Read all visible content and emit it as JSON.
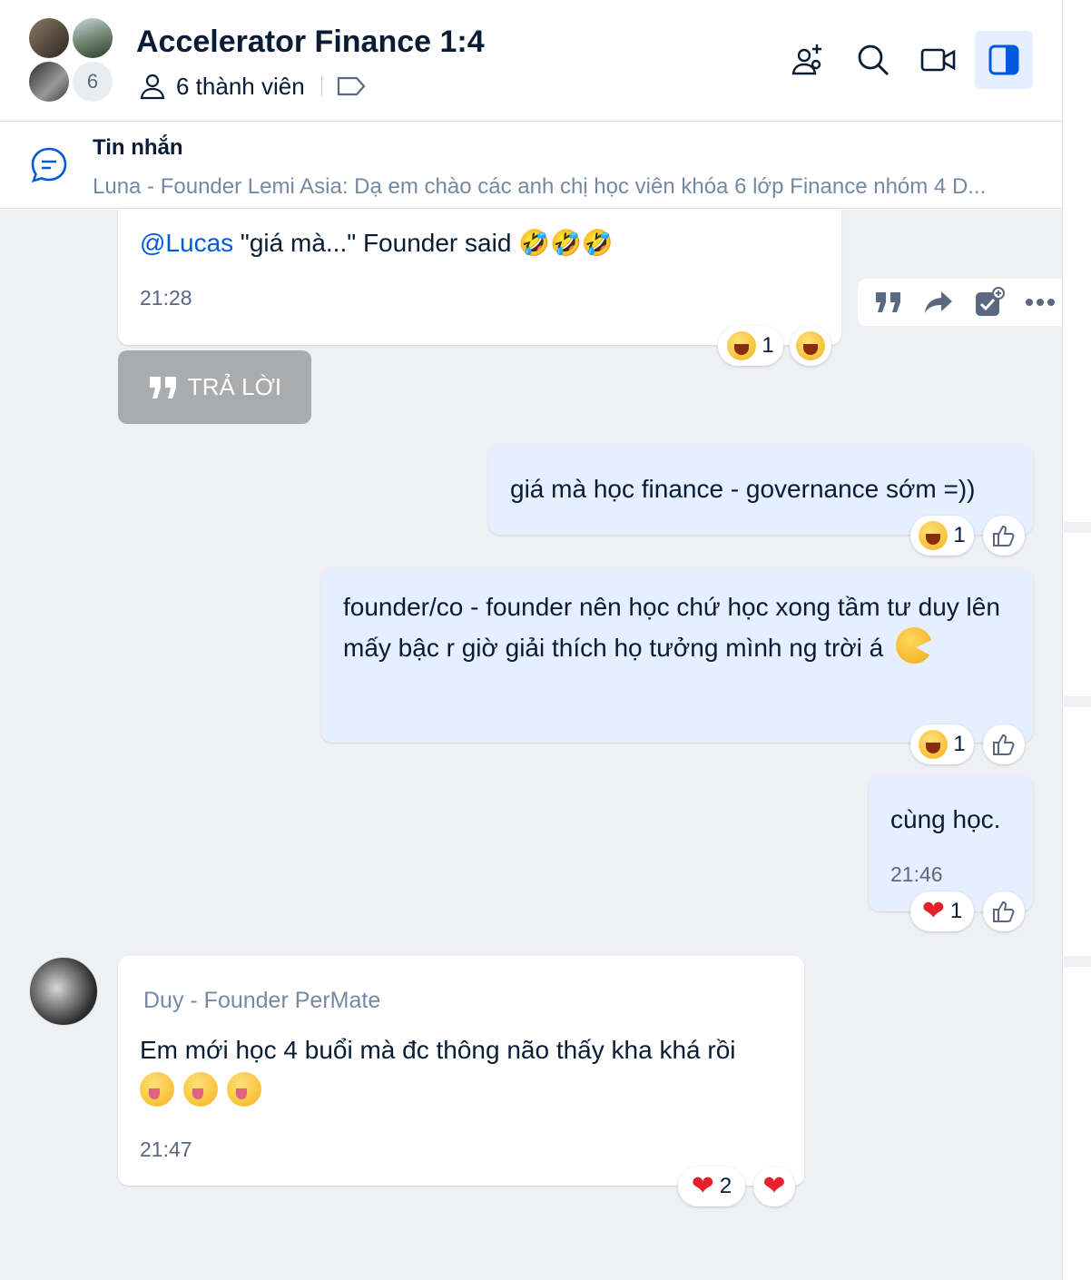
{
  "header": {
    "title": "Accelerator Finance 1:4",
    "avatar_more_count": "6",
    "members_label": "6 thành viên",
    "icons": [
      "add-member-icon",
      "search-icon",
      "video-call-icon",
      "sidebar-toggle-icon"
    ],
    "accent_color": "#005ae0"
  },
  "pinned": {
    "title": "Tin nhắn",
    "text": "Luna - Founder Lemi Asia: Dạ em chào các anh chị học viên khóa 6 lớp Finance nhóm 4 D..."
  },
  "messages": [
    {
      "mention": "@Lucas",
      "text": " \"giá mà...\" Founder said 🤣🤣🤣",
      "time": "21:28",
      "reaction_count": "1"
    },
    {
      "reply_label": "TRẢ LỜI"
    },
    {
      "text": "giá mà học finance - governance sớm =))",
      "reaction_count": "1"
    },
    {
      "text": "founder/co - founder nên học chứ học xong tầm tư duy lên mấy bậc r giờ giải thích họ tưởng mình ng trời á",
      "reaction_count": "1"
    },
    {
      "text": "cùng học.",
      "time": "21:46",
      "reaction_count": "1"
    },
    {
      "sender": "Duy - Founder PerMate",
      "text": "Em mới học 4 buổi mà đc thông não thấy kha khá rồi",
      "time": "21:47",
      "reaction_count": "2"
    }
  ]
}
